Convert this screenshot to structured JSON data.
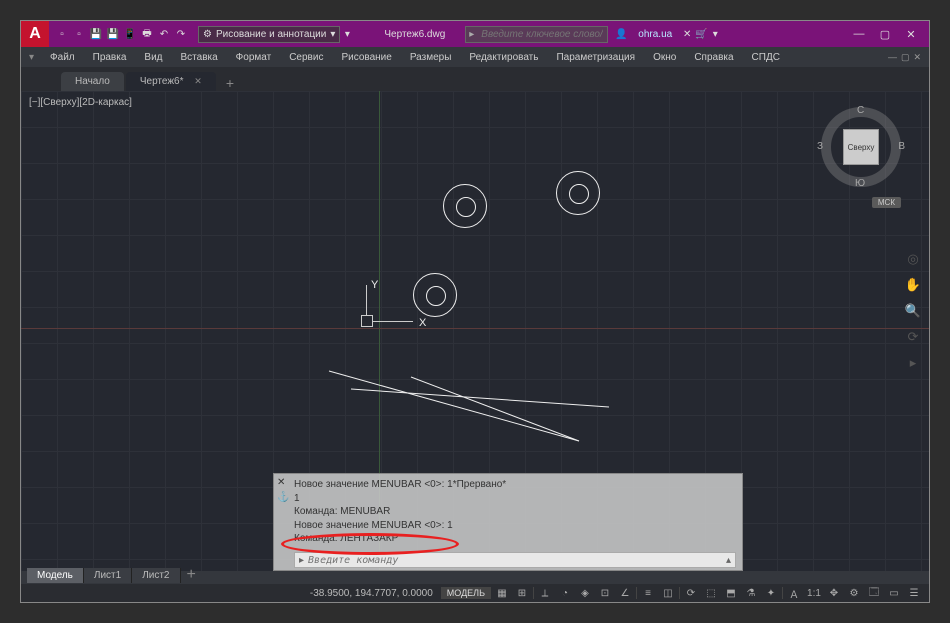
{
  "titlebar": {
    "workspace_label": "Рисование и аннотации",
    "document_name": "Чертеж6.dwg",
    "search_placeholder": "Введите ключевое слово/фразу",
    "account_name": "ohra.ua"
  },
  "menubar": {
    "items": [
      "Файл",
      "Правка",
      "Вид",
      "Вставка",
      "Формат",
      "Сервис",
      "Рисование",
      "Размеры",
      "Редактировать",
      "Параметризация",
      "Окно",
      "Справка",
      "СПДС"
    ]
  },
  "doc_tabs": {
    "home": "Начало",
    "active": "Чертеж6*"
  },
  "viewport": {
    "label": "[−][Сверху][2D-каркас]",
    "ucs_x": "X",
    "ucs_y": "Y"
  },
  "viewcube": {
    "face": "Сверху",
    "n": "С",
    "s": "Ю",
    "e": "В",
    "w": "З",
    "wcs": "МСК"
  },
  "command_window": {
    "history": [
      "Новое значение MENUBAR <0>: 1*Прервано*",
      "1",
      "Команда: MENUBAR",
      "Новое значение MENUBAR <0>: 1",
      "Команда: ЛЕНТАЗАКР"
    ],
    "prompt_placeholder": "Введите команду",
    "toggle": "▸"
  },
  "layout_tabs": {
    "model": "Модель",
    "sheet1": "Лист1",
    "sheet2": "Лист2"
  },
  "statusbar": {
    "coords": "-38.9500, 194.7707, 0.0000",
    "model_badge": "МОДЕЛЬ",
    "scale": "1:1"
  }
}
